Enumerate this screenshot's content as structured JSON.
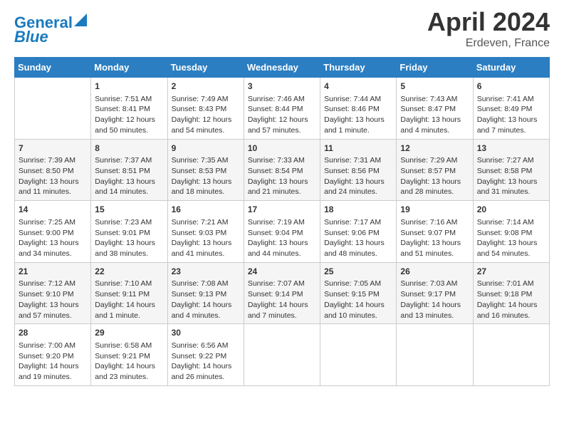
{
  "header": {
    "logo_line1": "General",
    "logo_line2": "Blue",
    "title": "April 2024",
    "subtitle": "Erdeven, France"
  },
  "days_of_week": [
    "Sunday",
    "Monday",
    "Tuesday",
    "Wednesday",
    "Thursday",
    "Friday",
    "Saturday"
  ],
  "weeks": [
    [
      {
        "day": "",
        "info": ""
      },
      {
        "day": "1",
        "info": "Sunrise: 7:51 AM\nSunset: 8:41 PM\nDaylight: 12 hours\nand 50 minutes."
      },
      {
        "day": "2",
        "info": "Sunrise: 7:49 AM\nSunset: 8:43 PM\nDaylight: 12 hours\nand 54 minutes."
      },
      {
        "day": "3",
        "info": "Sunrise: 7:46 AM\nSunset: 8:44 PM\nDaylight: 12 hours\nand 57 minutes."
      },
      {
        "day": "4",
        "info": "Sunrise: 7:44 AM\nSunset: 8:46 PM\nDaylight: 13 hours\nand 1 minute."
      },
      {
        "day": "5",
        "info": "Sunrise: 7:43 AM\nSunset: 8:47 PM\nDaylight: 13 hours\nand 4 minutes."
      },
      {
        "day": "6",
        "info": "Sunrise: 7:41 AM\nSunset: 8:49 PM\nDaylight: 13 hours\nand 7 minutes."
      }
    ],
    [
      {
        "day": "7",
        "info": "Sunrise: 7:39 AM\nSunset: 8:50 PM\nDaylight: 13 hours\nand 11 minutes."
      },
      {
        "day": "8",
        "info": "Sunrise: 7:37 AM\nSunset: 8:51 PM\nDaylight: 13 hours\nand 14 minutes."
      },
      {
        "day": "9",
        "info": "Sunrise: 7:35 AM\nSunset: 8:53 PM\nDaylight: 13 hours\nand 18 minutes."
      },
      {
        "day": "10",
        "info": "Sunrise: 7:33 AM\nSunset: 8:54 PM\nDaylight: 13 hours\nand 21 minutes."
      },
      {
        "day": "11",
        "info": "Sunrise: 7:31 AM\nSunset: 8:56 PM\nDaylight: 13 hours\nand 24 minutes."
      },
      {
        "day": "12",
        "info": "Sunrise: 7:29 AM\nSunset: 8:57 PM\nDaylight: 13 hours\nand 28 minutes."
      },
      {
        "day": "13",
        "info": "Sunrise: 7:27 AM\nSunset: 8:58 PM\nDaylight: 13 hours\nand 31 minutes."
      }
    ],
    [
      {
        "day": "14",
        "info": "Sunrise: 7:25 AM\nSunset: 9:00 PM\nDaylight: 13 hours\nand 34 minutes."
      },
      {
        "day": "15",
        "info": "Sunrise: 7:23 AM\nSunset: 9:01 PM\nDaylight: 13 hours\nand 38 minutes."
      },
      {
        "day": "16",
        "info": "Sunrise: 7:21 AM\nSunset: 9:03 PM\nDaylight: 13 hours\nand 41 minutes."
      },
      {
        "day": "17",
        "info": "Sunrise: 7:19 AM\nSunset: 9:04 PM\nDaylight: 13 hours\nand 44 minutes."
      },
      {
        "day": "18",
        "info": "Sunrise: 7:17 AM\nSunset: 9:06 PM\nDaylight: 13 hours\nand 48 minutes."
      },
      {
        "day": "19",
        "info": "Sunrise: 7:16 AM\nSunset: 9:07 PM\nDaylight: 13 hours\nand 51 minutes."
      },
      {
        "day": "20",
        "info": "Sunrise: 7:14 AM\nSunset: 9:08 PM\nDaylight: 13 hours\nand 54 minutes."
      }
    ],
    [
      {
        "day": "21",
        "info": "Sunrise: 7:12 AM\nSunset: 9:10 PM\nDaylight: 13 hours\nand 57 minutes."
      },
      {
        "day": "22",
        "info": "Sunrise: 7:10 AM\nSunset: 9:11 PM\nDaylight: 14 hours\nand 1 minute."
      },
      {
        "day": "23",
        "info": "Sunrise: 7:08 AM\nSunset: 9:13 PM\nDaylight: 14 hours\nand 4 minutes."
      },
      {
        "day": "24",
        "info": "Sunrise: 7:07 AM\nSunset: 9:14 PM\nDaylight: 14 hours\nand 7 minutes."
      },
      {
        "day": "25",
        "info": "Sunrise: 7:05 AM\nSunset: 9:15 PM\nDaylight: 14 hours\nand 10 minutes."
      },
      {
        "day": "26",
        "info": "Sunrise: 7:03 AM\nSunset: 9:17 PM\nDaylight: 14 hours\nand 13 minutes."
      },
      {
        "day": "27",
        "info": "Sunrise: 7:01 AM\nSunset: 9:18 PM\nDaylight: 14 hours\nand 16 minutes."
      }
    ],
    [
      {
        "day": "28",
        "info": "Sunrise: 7:00 AM\nSunset: 9:20 PM\nDaylight: 14 hours\nand 19 minutes."
      },
      {
        "day": "29",
        "info": "Sunrise: 6:58 AM\nSunset: 9:21 PM\nDaylight: 14 hours\nand 23 minutes."
      },
      {
        "day": "30",
        "info": "Sunrise: 6:56 AM\nSunset: 9:22 PM\nDaylight: 14 hours\nand 26 minutes."
      },
      {
        "day": "",
        "info": ""
      },
      {
        "day": "",
        "info": ""
      },
      {
        "day": "",
        "info": ""
      },
      {
        "day": "",
        "info": ""
      }
    ]
  ]
}
